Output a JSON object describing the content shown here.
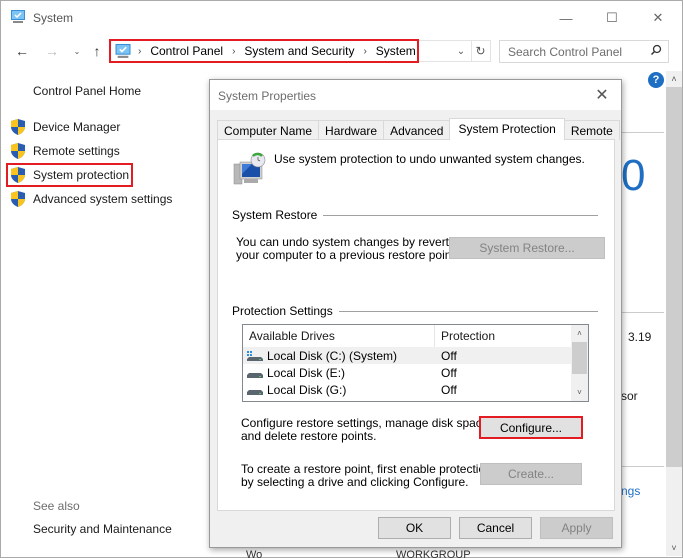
{
  "window": {
    "title": "System",
    "controls": {
      "minimize": "—",
      "maximize": "☐",
      "close": "✕"
    }
  },
  "nav": {
    "back": "←",
    "forward": "→",
    "recent": "⌄",
    "up": "↑",
    "breadcrumb": [
      "Control Panel",
      "System and Security",
      "System"
    ],
    "separator": "›",
    "dropdown": "⌄",
    "refresh": "↻",
    "search_placeholder": "Search Control Panel",
    "search_icon": "⌕"
  },
  "sidebar": {
    "home": "Control Panel Home",
    "items": [
      {
        "label": "Device Manager",
        "icon": "shield-icon"
      },
      {
        "label": "Remote settings",
        "icon": "shield-icon"
      },
      {
        "label": "System protection",
        "icon": "shield-icon",
        "highlighted": true
      },
      {
        "label": "Advanced system settings",
        "icon": "shield-icon"
      }
    ],
    "see_also": "See also",
    "see_also_items": [
      "Security and Maintenance"
    ]
  },
  "main": {
    "help": "?",
    "big_text": "0",
    "partial_value_1": "3.19",
    "partial_value_2": "sor",
    "partial_link": "ngs",
    "partial_bottom_1": "Wo",
    "partial_bottom_2": "WORKGROUP",
    "scroll_up": "˄",
    "scroll_down": "˅"
  },
  "dialog": {
    "title": "System Properties",
    "close": "✕",
    "tabs": [
      {
        "label": "Computer Name",
        "active": false
      },
      {
        "label": "Hardware",
        "active": false
      },
      {
        "label": "Advanced",
        "active": false
      },
      {
        "label": "System Protection",
        "active": true
      },
      {
        "label": "Remote",
        "active": false
      }
    ],
    "intro": "Use system protection to undo unwanted system changes.",
    "system_restore": {
      "group_label": "System Restore",
      "description_1": "You can undo system changes by reverting",
      "description_2": "your computer to a previous restore point.",
      "button": "System Restore..."
    },
    "protection_settings": {
      "group_label": "Protection Settings",
      "columns": [
        "Available Drives",
        "Protection"
      ],
      "drives": [
        {
          "name": "Local Disk (C:) (System)",
          "protection": "Off",
          "system": true,
          "selected": true
        },
        {
          "name": "Local Disk (E:)",
          "protection": "Off",
          "system": false,
          "selected": false
        },
        {
          "name": "Local Disk (G:)",
          "protection": "Off",
          "system": false,
          "selected": false
        }
      ],
      "configure_desc_1": "Configure restore settings, manage disk space,",
      "configure_desc_2": "and delete restore points.",
      "configure_button": "Configure...",
      "create_desc_1": "To create a restore point, first enable protection",
      "create_desc_2": "by selecting a drive and clicking Configure.",
      "create_button": "Create..."
    },
    "buttons": {
      "ok": "OK",
      "cancel": "Cancel",
      "apply": "Apply"
    }
  },
  "colors": {
    "highlight_red": "#e31b23",
    "link_blue": "#1e6fc4"
  }
}
